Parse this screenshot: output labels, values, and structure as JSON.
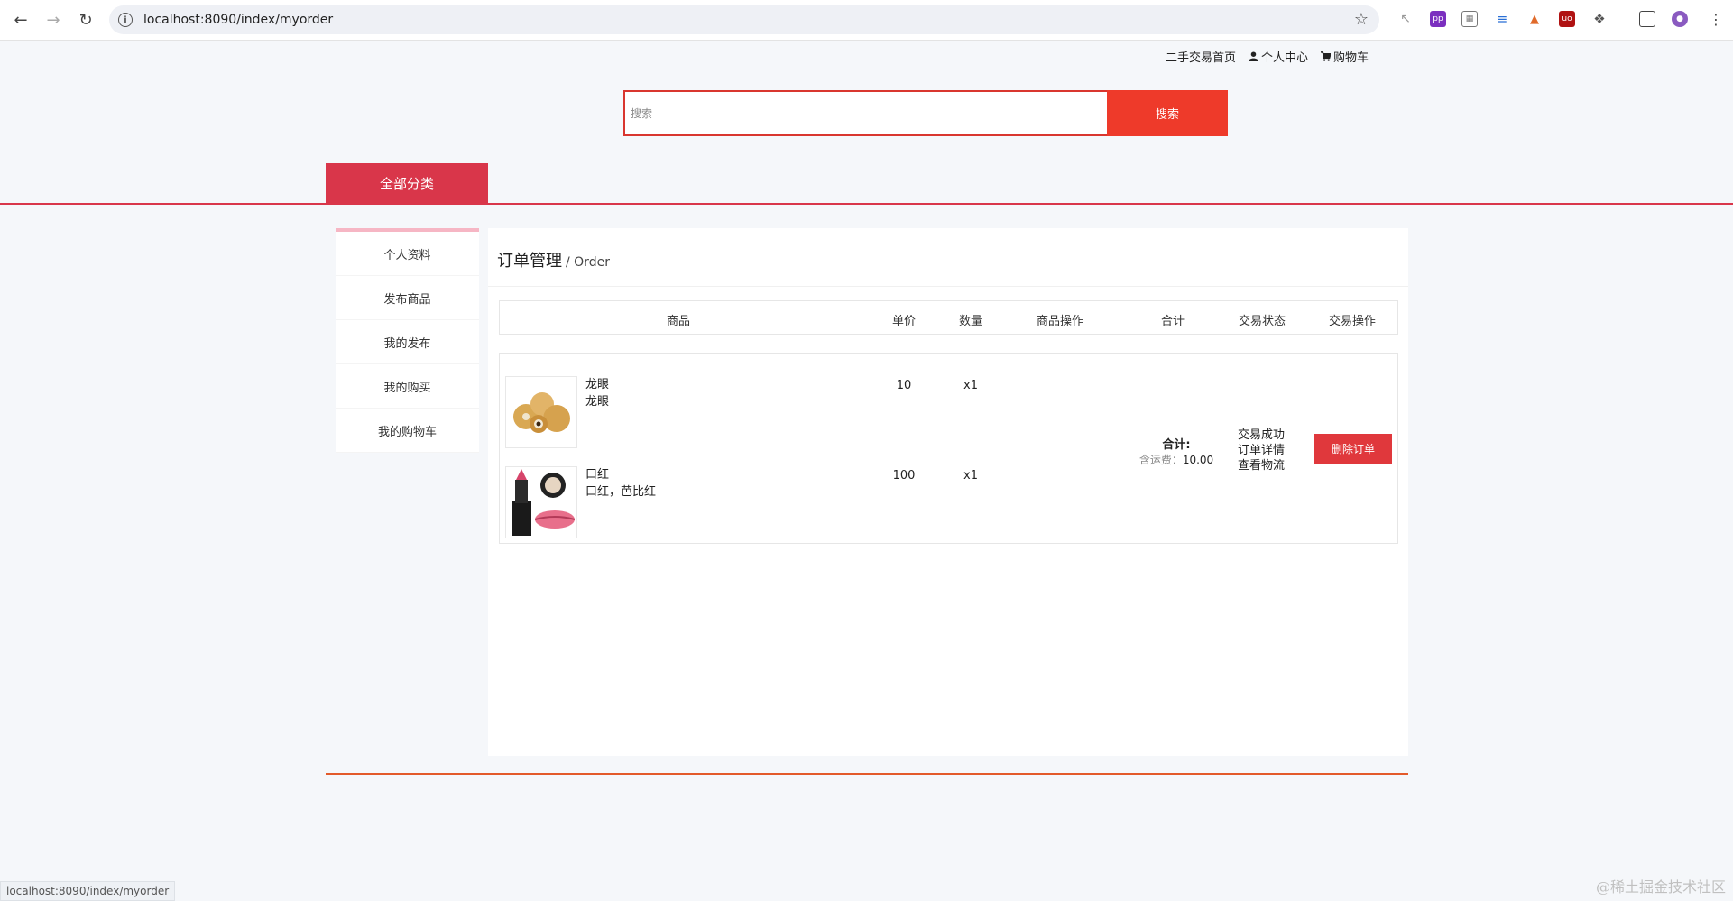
{
  "browser": {
    "url": "localhost:8090/index/myorder",
    "status_url": "localhost:8090/index/myorder"
  },
  "toplinks": {
    "home": "二手交易首页",
    "personal": "个人中心",
    "cart": "购物车"
  },
  "search": {
    "placeholder": "搜索",
    "button": "搜索"
  },
  "category_button": "全部分类",
  "sidebar": {
    "items": [
      {
        "label": "个人资料"
      },
      {
        "label": "发布商品"
      },
      {
        "label": "我的发布"
      },
      {
        "label": "我的购买"
      },
      {
        "label": "我的购物车"
      }
    ]
  },
  "main": {
    "title": "订单管理",
    "subtitle": "/ Order",
    "columns": [
      "商品",
      "单价",
      "数量",
      "商品操作",
      "合计",
      "交易状态",
      "交易操作"
    ],
    "order": {
      "items": [
        {
          "name": "龙眼",
          "desc": "龙眼",
          "price": "10",
          "qty": "x1",
          "image": "longan-image"
        },
        {
          "name": "口红",
          "desc": "口红，芭比红",
          "price": "100",
          "qty": "x1",
          "image": "lipstick-image"
        }
      ],
      "total_label": "合计:",
      "shipping_label": "含运费：",
      "total": "10.00",
      "status": [
        "交易成功",
        "订单详情",
        "查看物流"
      ],
      "delete_button": "删除订单"
    }
  },
  "watermark": "@稀土掘金技术社区",
  "colors": {
    "accent": "#d9364a",
    "search_button": "#ee3a2a",
    "delete_button": "#e0383c"
  }
}
